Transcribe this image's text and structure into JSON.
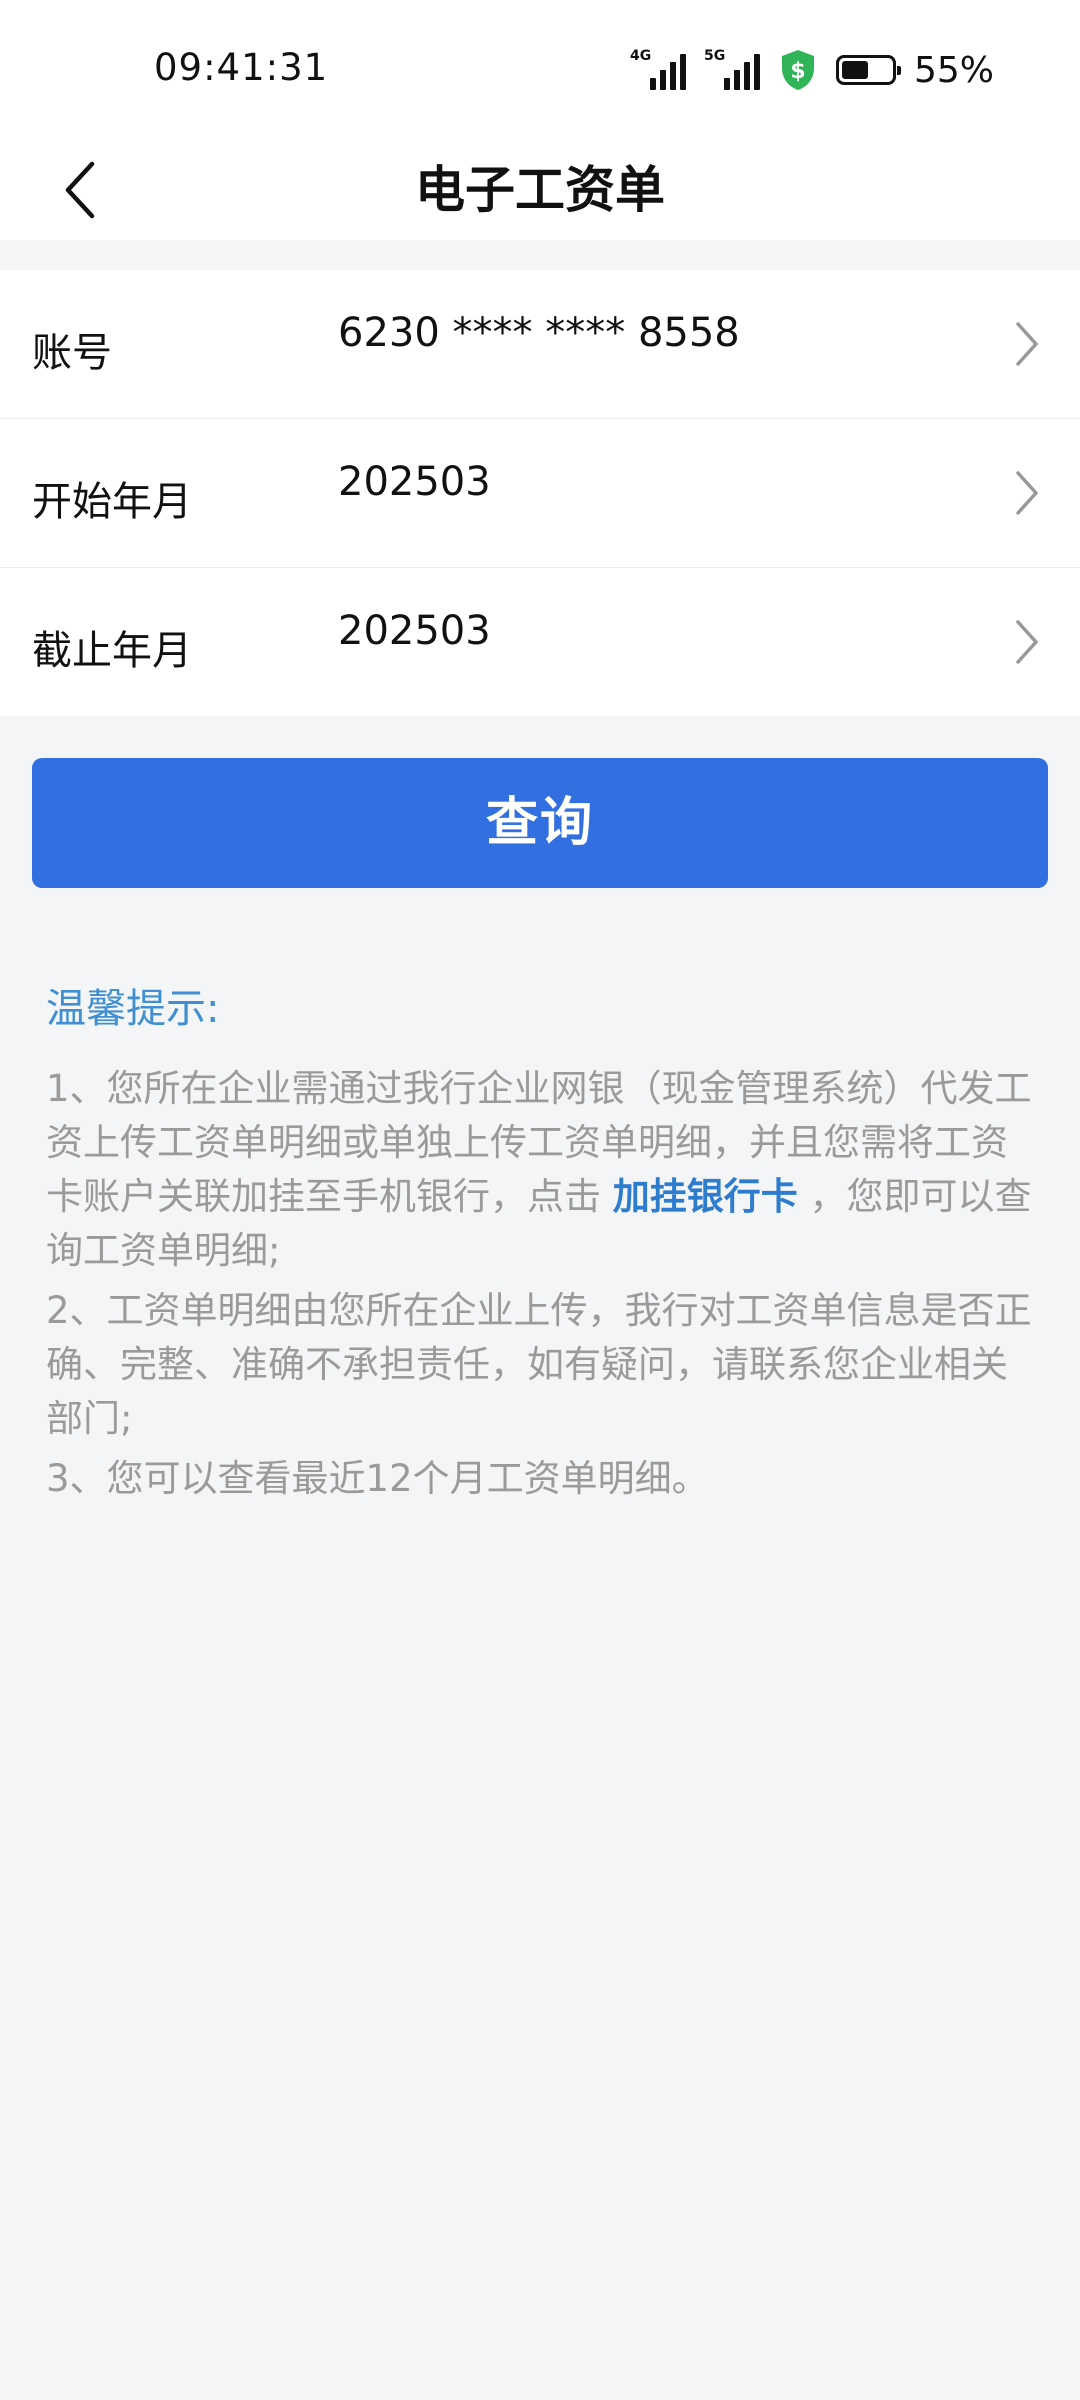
{
  "status_bar": {
    "time": "09:41:31",
    "network_1": "4G",
    "network_2": "5G",
    "security_icon": "green-shield-dollar-icon",
    "battery_level": 0.55,
    "battery_text": "55%"
  },
  "nav": {
    "title": "电子工资单",
    "back_icon": "chevron-left-icon"
  },
  "form": {
    "rows": [
      {
        "label": "账号",
        "value": "6230 **** **** 8558"
      },
      {
        "label": "开始年月",
        "value": "202503"
      },
      {
        "label": "截止年月",
        "value": "202503"
      }
    ]
  },
  "query_button": {
    "label": "查询"
  },
  "tips": {
    "title": "温馨提示:",
    "item1_before": "1、您所在企业需通过我行企业网银（现金管理系统）代发工资上传工资单明细或单独上传工资单明细，并且您需将工资卡账户关联加挂至手机银行，点击 ",
    "item1_link": "加挂银行卡",
    "item1_after": " ，您即可以查询工资单明细;",
    "item2": "2、工资单明细由您所在企业上传，我行对工资单信息是否正确、完整、准确不承担责任，如有疑问，请联系您企业相关部门;",
    "item3": "3、您可以查看最近12个月工资单明细。"
  },
  "colors": {
    "primary_button": "#3270e2",
    "tips_title": "#3f8fd2",
    "link": "#2d7ccd",
    "tips_text": "#9a9a9a",
    "shield": "#2fb457",
    "background": "#f4f5f7"
  }
}
